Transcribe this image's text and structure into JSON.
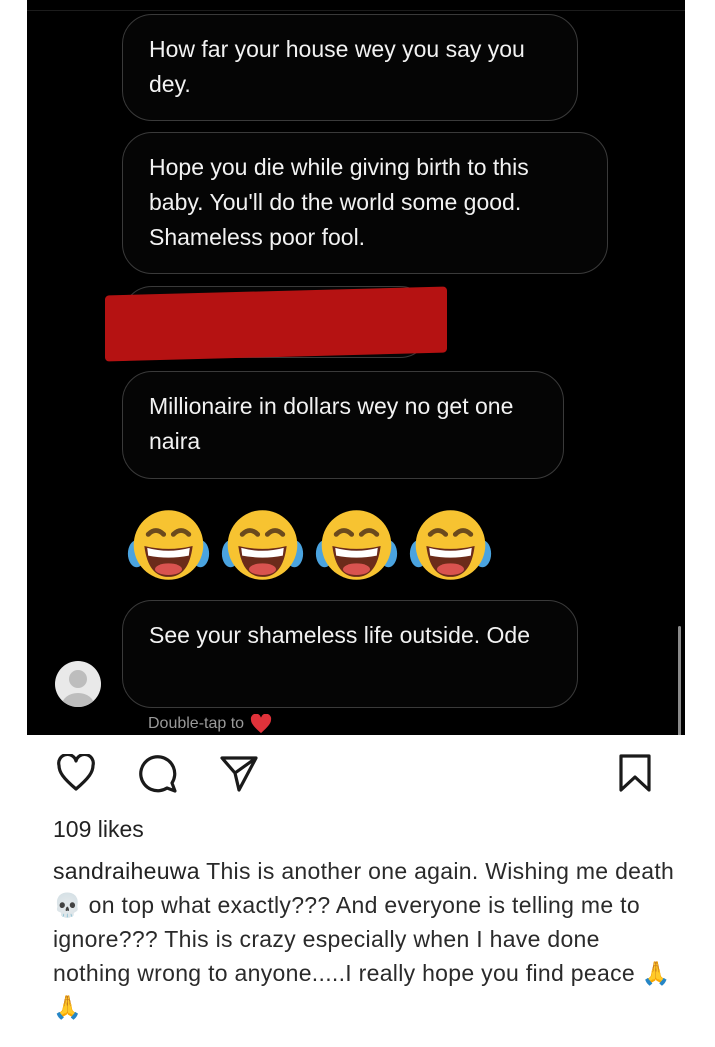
{
  "chat": {
    "messages": [
      "How far your house wey you say you dey.",
      "Hope you die while giving birth to this baby. You'll do the world some good. Shameless poor fool.",
      "Millionaire in dollars wey no get one naira",
      "See your shameless life outside. Ode"
    ],
    "emoji_reaction": "😂😂😂😂",
    "hint_text": "Double-tap to",
    "hint_icon": "heart-icon",
    "redaction_color": "#b51212"
  },
  "post": {
    "actions": [
      "like-icon",
      "comment-icon",
      "share-icon",
      "save-icon"
    ],
    "likes": "109 likes",
    "username": "sandraiheuwa",
    "caption": "This is another one again. Wishing me death 💀 on top what exactly??? And everyone is telling me to ignore??? This is crazy especially when I have done nothing wrong to anyone.....I really hope you find peace 🙏🙏"
  }
}
